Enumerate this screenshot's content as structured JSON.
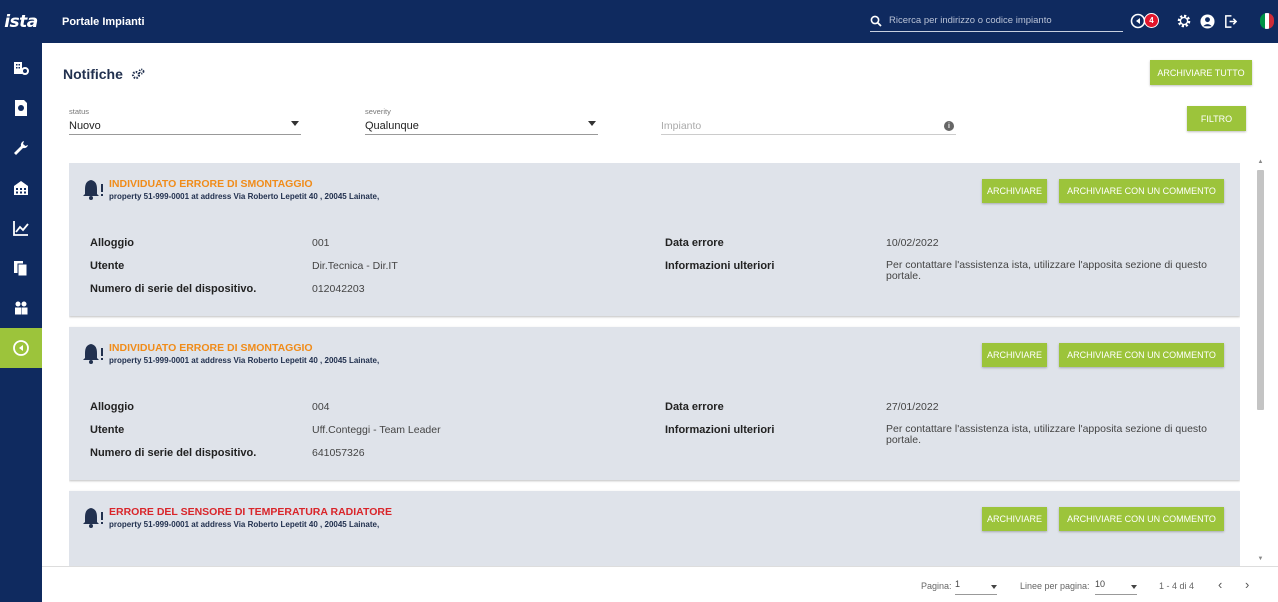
{
  "header": {
    "logo_text": "ista",
    "app_title": "Portale Impianti",
    "search_placeholder": "Ricerca per indirizzo o codice impianto",
    "notification_count": "4",
    "flag_colors": [
      "#009246",
      "#ffffff",
      "#ce2b37"
    ]
  },
  "sidebar": {
    "items": [
      {
        "icon": "building-settings-icon",
        "active": false
      },
      {
        "icon": "document-euro-icon",
        "active": false
      },
      {
        "icon": "wrench-icon",
        "active": false
      },
      {
        "icon": "building-icon",
        "active": false
      },
      {
        "icon": "line-chart-icon",
        "active": false
      },
      {
        "icon": "documents-icon",
        "active": false
      },
      {
        "icon": "users-icon",
        "active": false
      },
      {
        "icon": "notification-arrow-icon",
        "active": true
      }
    ]
  },
  "page": {
    "title": "Notifiche",
    "archive_all_label": "ARCHIVIARE TUTTO",
    "filter_label": "FILTRO"
  },
  "filters": {
    "status": {
      "label": "status",
      "value": "Nuovo"
    },
    "severity": {
      "label": "severity",
      "value": "Qualunque"
    },
    "impianto": {
      "placeholder": "Impianto"
    }
  },
  "labels": {
    "alloggio": "Alloggio",
    "utente": "Utente",
    "numero_serie": "Numero di serie del dispositivo.",
    "data_errore": "Data errore",
    "info_ulteriori": "Informazioni ulteriori",
    "archive": "ARCHIVIARE",
    "archive_comment": "ARCHIVIARE CON UN COMMENTO"
  },
  "notifications": [
    {
      "title": "INDIVIDUATO ERRORE DI SMONTAGGIO",
      "severity_color": "#f08c1a",
      "subtitle": "property 51-999-0001 at address Via Roberto Lepetit 40 , 20045 Lainate,",
      "alloggio": "001",
      "utente": "Dir.Tecnica - Dir.IT",
      "numero_serie": "012042203",
      "data_errore": "10/02/2022",
      "info": "Per contattare l'assistenza ista, utilizzare l'apposita sezione di questo portale."
    },
    {
      "title": "INDIVIDUATO ERRORE DI SMONTAGGIO",
      "severity_color": "#f08c1a",
      "subtitle": "property 51-999-0001 at address Via Roberto Lepetit 40 , 20045 Lainate,",
      "alloggio": "004",
      "utente": "Uff.Conteggi - Team Leader",
      "numero_serie": "641057326",
      "data_errore": "27/01/2022",
      "info": "Per contattare l'assistenza ista, utilizzare l'apposita sezione di questo portale."
    },
    {
      "title": "ERRORE DEL SENSORE DI TEMPERATURA RADIATORE",
      "severity_color": "#d9252a",
      "subtitle": "property 51-999-0001 at address Via Roberto Lepetit 40 , 20045 Lainate,"
    }
  ],
  "pagination": {
    "page_label": "Pagina:",
    "page_value": "1",
    "rows_label": "Linee per pagina:",
    "rows_value": "10",
    "range": "1 - 4 di 4",
    "prev": "‹",
    "next": "›"
  }
}
